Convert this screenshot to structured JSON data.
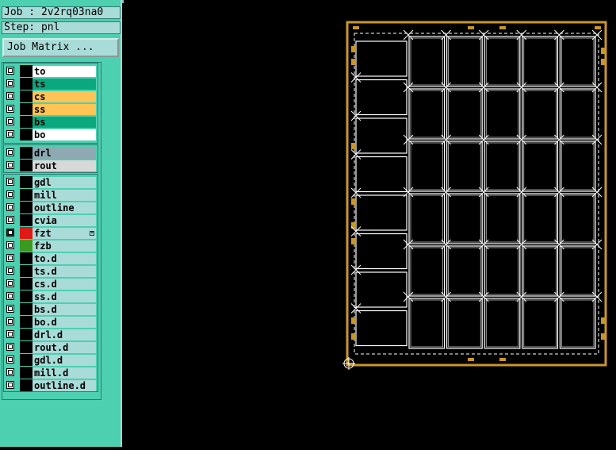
{
  "job": {
    "label": "Job : 2v2rq03na0"
  },
  "step": {
    "label": "Step: pnl"
  },
  "job_matrix": {
    "label": "Job Matrix ..."
  },
  "layers": {
    "group1": [
      {
        "name": "to",
        "color": "#ffffff"
      },
      {
        "name": "ts",
        "color": "#0aa87c"
      },
      {
        "name": "cs",
        "color": "#ffc455"
      },
      {
        "name": "ss",
        "color": "#ffc455"
      },
      {
        "name": "bs",
        "color": "#0aa87c"
      },
      {
        "name": "bo",
        "color": "#ffffff"
      }
    ],
    "group2": [
      {
        "name": "drl",
        "color": "#8fa9b3"
      },
      {
        "name": "rout",
        "color": "#d8d8d8"
      }
    ],
    "group3": [
      {
        "name": "gdl",
        "color": "#a9dcd8",
        "swatch": "#000000"
      },
      {
        "name": "mill",
        "color": "#a9dcd8",
        "swatch": "#000000"
      },
      {
        "name": "outline",
        "color": "#a9dcd8",
        "swatch": "#000000"
      },
      {
        "name": "cvia",
        "color": "#a9dcd8",
        "swatch": "#000000"
      },
      {
        "name": "fzt",
        "color": "#a9dcd8",
        "swatch": "#e01818",
        "active": true,
        "flag": true
      },
      {
        "name": "fzb",
        "color": "#a9dcd8",
        "swatch": "#3a9a20"
      },
      {
        "name": "to.d",
        "color": "#a9dcd8",
        "swatch": "#000000"
      },
      {
        "name": "ts.d",
        "color": "#a9dcd8",
        "swatch": "#000000"
      },
      {
        "name": "cs.d",
        "color": "#a9dcd8",
        "swatch": "#000000"
      },
      {
        "name": "ss.d",
        "color": "#a9dcd8",
        "swatch": "#000000"
      },
      {
        "name": "bs.d",
        "color": "#a9dcd8",
        "swatch": "#000000"
      },
      {
        "name": "bo.d",
        "color": "#a9dcd8",
        "swatch": "#000000"
      },
      {
        "name": "drl.d",
        "color": "#a9dcd8",
        "swatch": "#000000"
      },
      {
        "name": "rout.d",
        "color": "#a9dcd8",
        "swatch": "#000000"
      },
      {
        "name": "gdl.d",
        "color": "#a9dcd8",
        "swatch": "#000000"
      },
      {
        "name": "mill.d",
        "color": "#a9dcd8",
        "swatch": "#000000"
      },
      {
        "name": "outline.d",
        "color": "#a9dcd8",
        "swatch": "#000000"
      }
    ]
  },
  "colors": {
    "panel_frame": "#c8962e",
    "board_lines": "#ffffff",
    "sidebar": "#4dd0b0",
    "background": "#000000"
  },
  "panel": {
    "left_column_rows": 8,
    "grid_columns": 5,
    "grid_rows": 6
  }
}
